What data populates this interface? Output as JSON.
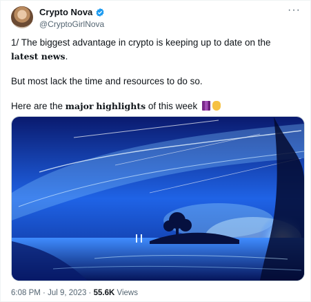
{
  "tweet": {
    "author_name": "Crypto Nova",
    "author_handle": "@CryptoGirlNova",
    "text_line1_start": "1/ The biggest advantage in crypto is keeping up to date on the ",
    "text_line1_bold": "latest news",
    "text_line1_end": ".",
    "text_line2": "But most lack the time and resources to do so.",
    "text_line3_start": "Here are the ",
    "text_line3_bold1": "major",
    "text_line3_bold2": "highlights",
    "text_line3_end": " of this week",
    "time": "6:08 PM",
    "separator": "·",
    "date": "Jul 9, 2023",
    "views_count": "55.6K",
    "views_label": "Views"
  },
  "icons": {
    "verified": "verified-badge-icon",
    "more": "more-options-icon",
    "emoji1": "thread-emoji-icon",
    "emoji2": "pointing-down-emoji-icon"
  },
  "colors": {
    "verified": "#1d9bf0",
    "secondary_text": "#536471",
    "primary_text": "#0f1419"
  }
}
